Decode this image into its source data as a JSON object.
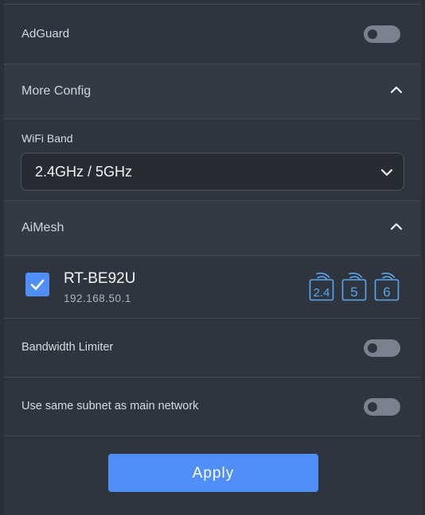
{
  "adguard": {
    "label": "AdGuard",
    "enabled": false
  },
  "more_config": {
    "title": "More Config",
    "expanded": true
  },
  "wifi_band": {
    "label": "WiFi Band",
    "selected": "2.4GHz / 5GHz"
  },
  "aimesh": {
    "title": "AiMesh",
    "expanded": true,
    "node": {
      "name": "RT-BE92U",
      "ip": "192.168.50.1",
      "checked": true,
      "bands": [
        "2.4",
        "5",
        "6"
      ]
    }
  },
  "bandwidth_limiter": {
    "label": "Bandwidth Limiter",
    "enabled": false
  },
  "same_subnet": {
    "label": "Use same subnet as main network",
    "enabled": false
  },
  "apply_label": "Apply",
  "colors": {
    "accent": "#4f8ff7",
    "toggle_off": "#7a8290",
    "band_icon": "#5aa7ee"
  }
}
